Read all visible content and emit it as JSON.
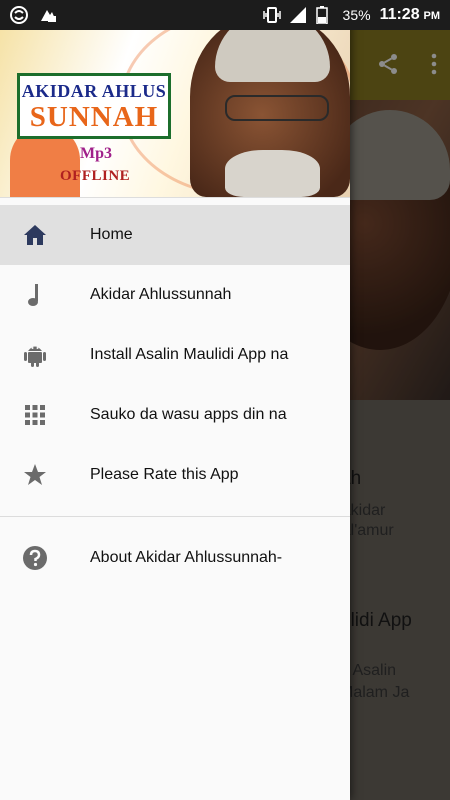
{
  "status_bar": {
    "battery_percent": "35%",
    "time": "11:28",
    "ampm": "PM"
  },
  "drawer": {
    "header": {
      "logo_line1": "AKIDAR AHLUS",
      "logo_line2": "SUNNAH",
      "mp3_label": "Mp3",
      "offline_label": "OFFLINE"
    },
    "items": [
      {
        "label": "Home",
        "icon": "home-icon",
        "selected": true
      },
      {
        "label": "Akidar Ahlussunnah",
        "icon": "music-note-icon"
      },
      {
        "label": "Install  Asalin Maulidi App na",
        "icon": "android-icon"
      },
      {
        "label": "Sauko da wasu apps din na",
        "icon": "apps-grid-icon"
      },
      {
        "label": "Please Rate this App",
        "icon": "star-icon"
      }
    ],
    "secondary_items": [
      {
        "label": "About Akidar Ahlussunnah-",
        "icon": "help-icon"
      }
    ]
  },
  "background": {
    "partial_texts": [
      "ah",
      "Akidar",
      "Al'amur",
      "ulidi App",
      "n Asalin",
      "Malam Ja"
    ]
  },
  "colors": {
    "toolbar": "#8a7c22",
    "logo_border": "#1c6e2c",
    "logo_blue": "#1b2a8a",
    "logo_orange": "#e8661a",
    "icon_gray": "#6b6b6b",
    "home_icon": "#2d3a5e"
  }
}
